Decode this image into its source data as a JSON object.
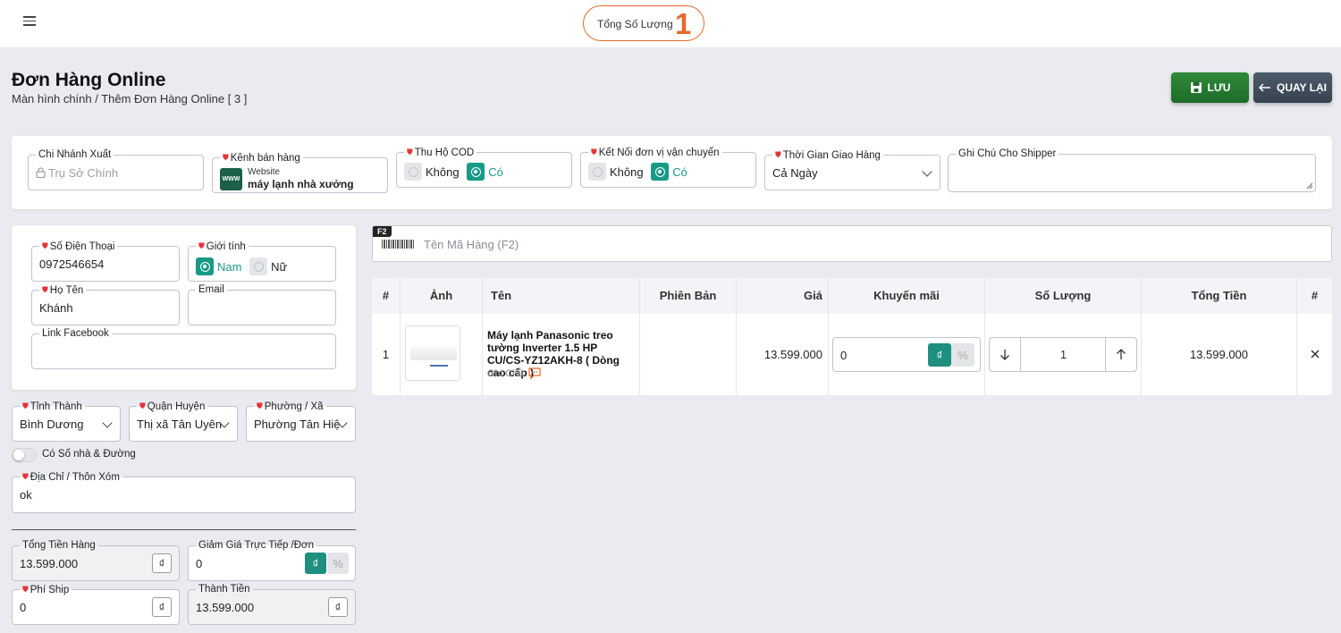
{
  "topbar": {
    "total_label": "Tổng Số Lượng",
    "total_value": "1"
  },
  "page": {
    "title": "Đơn Hàng Online",
    "breadcrumb": "Màn hình chính / Thêm Đơn Hàng Online [ 3 ]"
  },
  "actions": {
    "save_label": "LƯU",
    "back_label": "QUAY LẠI"
  },
  "order_info": {
    "branch_label": "Chi Nhánh Xuất",
    "branch_value": "Trụ Sở Chính",
    "channel_label": "Kênh bán hàng",
    "channel_icon_text": "WWW",
    "channel_type": "Website",
    "channel_value": "máy lạnh nhà xưởng",
    "cod_label": "Thu Hộ COD",
    "cod_no": "Không",
    "cod_yes": "Có",
    "shipping_label": "Kết Nối đơn vị vận chuyển",
    "shipping_no": "Không",
    "shipping_yes": "Có",
    "delivery_time_label": "Thời Gian Giao Hàng",
    "delivery_time_value": "Cả Ngày",
    "shipper_note_label": "Ghi Chú Cho Shipper",
    "shipper_note_value": ""
  },
  "customer": {
    "phone_label": "Số Điện Thoại",
    "phone_value": "0972546654",
    "gender_label": "Giới tính",
    "gender_male": "Nam",
    "gender_female": "Nữ",
    "name_label": "Họ Tên",
    "name_value": "Khánh",
    "email_label": "Email",
    "email_value": "",
    "facebook_label": "Link Facebook",
    "facebook_value": ""
  },
  "address": {
    "province_label": "Tỉnh Thành",
    "province_value": "Bình Dương",
    "district_label": "Quận Huyện",
    "district_value": "Thị xã Tân Uyên",
    "ward_label": "Phường / Xã",
    "ward_value": "Phường Tân Hiệp",
    "street_toggle_label": "Có Số nhà & Đường",
    "address_label": "Địa Chỉ / Thôn Xóm",
    "address_value": "ok"
  },
  "totals": {
    "subtotal_label": "Tổng Tiền Hàng",
    "subtotal_value": "13.599.000",
    "discount_label": "Giảm Giá Trực Tiếp /Đơn",
    "discount_value": "0",
    "ship_label": "Phí Ship",
    "ship_value": "0",
    "grand_label": "Thành Tiền",
    "grand_value": "13.599.000",
    "currency": "₫"
  },
  "search": {
    "shortcut": "F2",
    "placeholder": "Tên Mã Hàng (F2)"
  },
  "table": {
    "headers": [
      "#",
      "Ảnh",
      "Tên",
      "Phiên Bản",
      "Giá",
      "Khuyến mãi",
      "Số Lượng",
      "Tổng Tiền",
      "#"
    ],
    "rows": [
      {
        "index": "1",
        "name": "Máy lạnh Panasonic treo tường Inverter 1.5 HP CU/CS-YZ12AKH-8 ( Dòng cao cấp )",
        "note_label": "Ghi Chú",
        "version": "",
        "price": "13.599.000",
        "promo": "0",
        "qty": "1",
        "total": "13.599.000"
      }
    ]
  },
  "colors": {
    "accent": "#e8692a",
    "teal": "#179a86",
    "save_green": "#2f8a3a",
    "back_slate": "#4d5c6b",
    "required": "#e5343a"
  }
}
